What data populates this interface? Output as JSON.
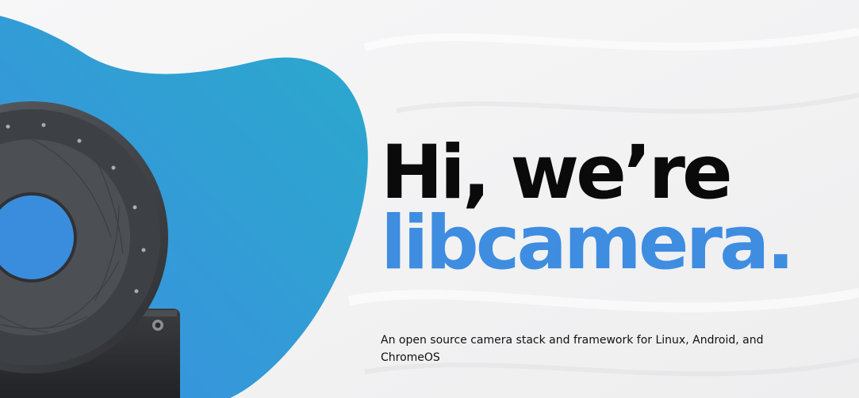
{
  "hero": {
    "headline_line1": "Hi, we’re",
    "headline_line2": "libcamera.",
    "tagline": "An open source camera stack and framework for Linux, Android, and ChromeOS"
  },
  "colors": {
    "background": "#f4f4f5",
    "blob_start": "#3b8fe0",
    "blob_end": "#2aa9cc",
    "headline": "#0a0a0a",
    "accent": "#3e8de0"
  },
  "icons": {
    "background": "light-wave-texture",
    "blob": "blue-blob-shape",
    "illustration": "camera-lens-module-image"
  }
}
